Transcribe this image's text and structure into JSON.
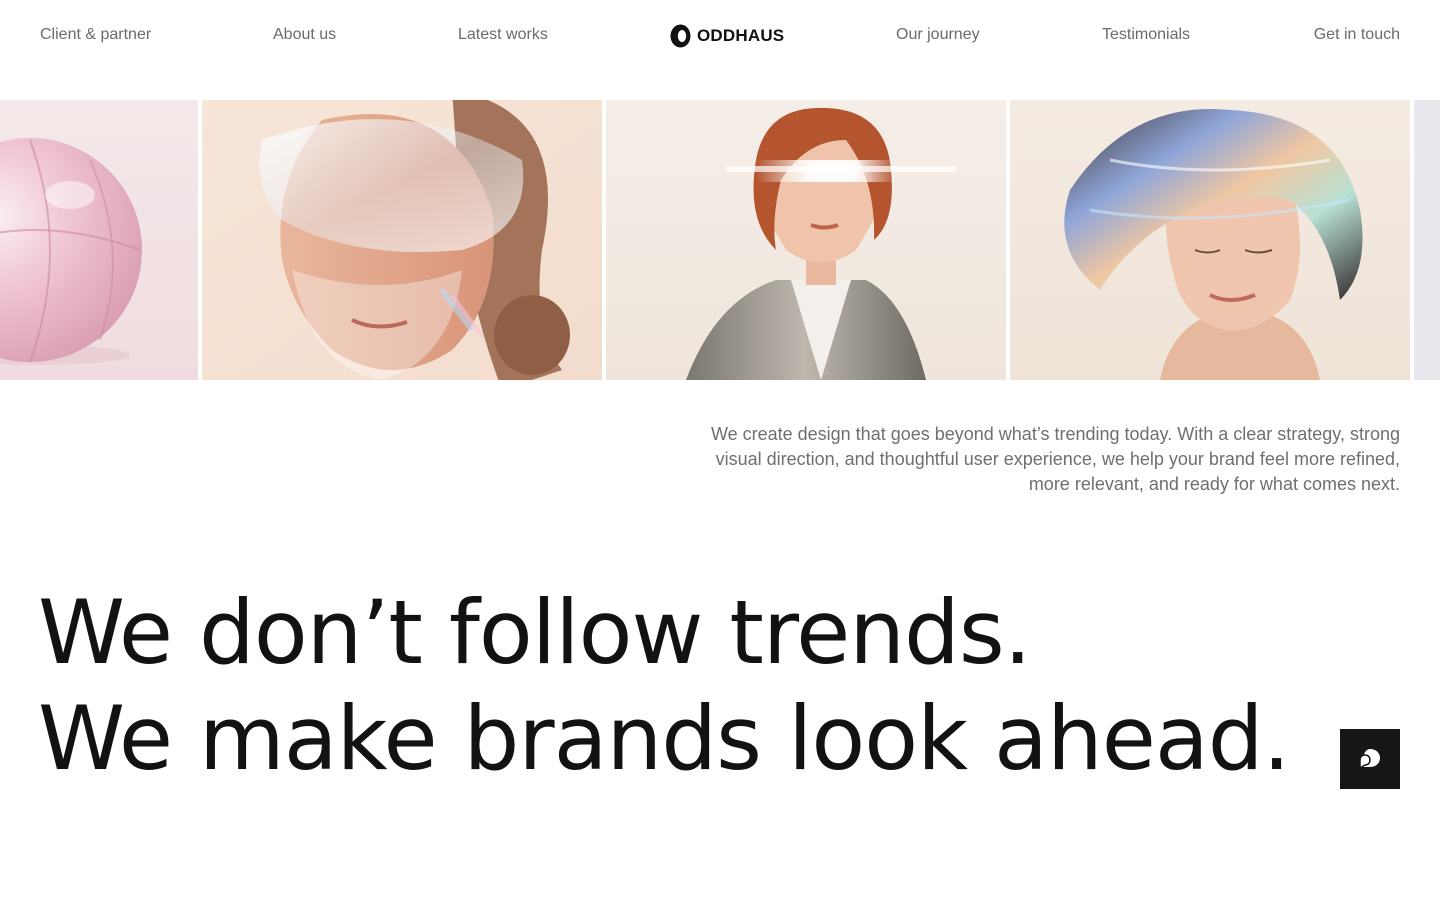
{
  "nav": {
    "links": [
      {
        "label": "Client & partner"
      },
      {
        "label": "About us"
      },
      {
        "label": "Latest works"
      },
      {
        "label": "Our journey"
      },
      {
        "label": "Testimonials"
      },
      {
        "label": "Get in touch"
      }
    ],
    "logo": {
      "text": "ODDHAUS",
      "icon": "oddhaus-logo-icon"
    }
  },
  "gallery": {
    "tiles": [
      {
        "subject": "pink iridescent sphere",
        "bg": "#f1dce0"
      },
      {
        "subject": "woman with glass mask",
        "bg": "#f6e3d6"
      },
      {
        "subject": "woman with light streak visor",
        "bg": "#f3ece6"
      },
      {
        "subject": "person with holographic hair",
        "bg": "#f2e8df"
      },
      {
        "subject": "partial tile",
        "bg": "#e9e9ee"
      }
    ]
  },
  "intro": {
    "text": "We create design that goes beyond what’s trending today. With a clear strategy, strong visual direction, and thoughtful user experience, we help your brand feel more refined, more relevant, and ready for what comes next."
  },
  "headline": {
    "line1": "We don’t follow trends.",
    "line2": "We make brands look ahead."
  },
  "chat_button": {
    "icon": "chat-bubble-icon"
  },
  "colors": {
    "text": "#121212",
    "muted": "#6b6b6b",
    "button_bg": "#161616",
    "background": "#ffffff"
  }
}
